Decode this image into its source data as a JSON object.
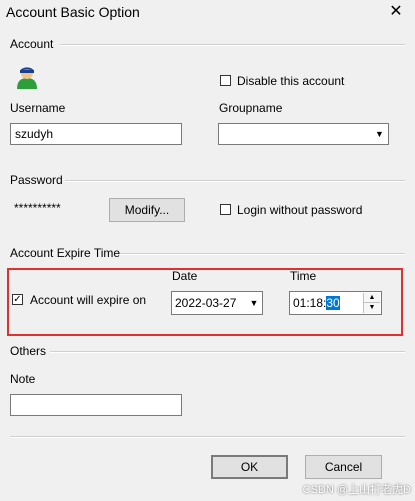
{
  "window": {
    "title": "Account Basic Option",
    "close_glyph": "✕"
  },
  "account": {
    "section_label": "Account",
    "avatar_icon": "user-icon",
    "disable_label": "Disable this account",
    "disable_checked": false,
    "username_label": "Username",
    "username_value": "szudyh",
    "groupname_label": "Groupname",
    "groupname_value": ""
  },
  "password": {
    "section_label": "Password",
    "masked_value": "**********",
    "modify_label": "Modify...",
    "login_without_label": "Login without password",
    "login_without_checked": false
  },
  "expire": {
    "section_label": "Account Expire Time",
    "checkbox_label": "Account will expire on",
    "checkbox_mark": "✓",
    "checked": true,
    "date_label": "Date",
    "date_value": "2022-03-27",
    "time_label": "Time",
    "time_prefix": "01:18:",
    "time_selected": "30"
  },
  "others": {
    "section_label": "Others",
    "note_label": "Note",
    "note_value": ""
  },
  "footer": {
    "ok_label": "OK",
    "cancel_label": "Cancel"
  },
  "dropdown_glyph": "▼",
  "watermark": "CSDN @上山打老虎D",
  "colors": {
    "highlight_border": "#e03030",
    "selection": "#0078d7"
  }
}
